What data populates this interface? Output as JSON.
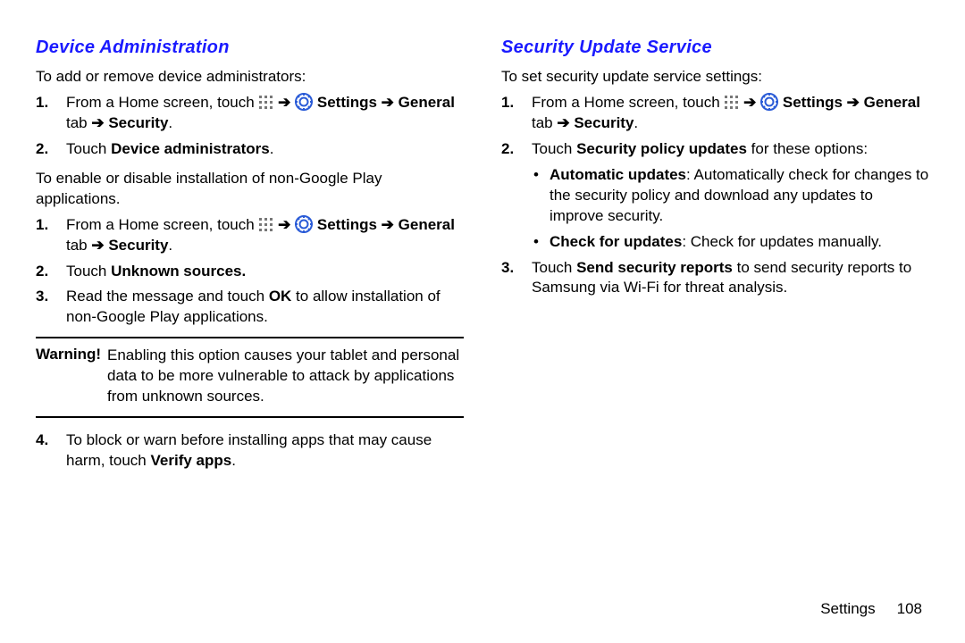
{
  "left": {
    "heading": "Device Administration",
    "intro1": "To add or remove device administrators:",
    "steps1": {
      "s1a": "From a Home screen, touch ",
      "s1b": " Settings ",
      "s1c": "General",
      "s1d": " tab ",
      "s1e": " Security",
      "s2a": "Touch ",
      "s2b": "Device administrators"
    },
    "intro2a": "To enable or disable installation of non-Google Play",
    "intro2b": "applications.",
    "steps2": {
      "s1a": "From a Home screen, touch ",
      "s1b": " Settings ",
      "s1c": "General",
      "s1d": " tab ",
      "s1e": " Security",
      "s2a": "Touch ",
      "s2b": "Unknown sources.",
      "s3a": "Read the message and touch ",
      "s3b": "OK",
      "s3c": " to allow installation of non-Google Play applications."
    },
    "warning_label": "Warning!",
    "warning_text": "Enabling this option causes your tablet and personal data to be more vulnerable to attack by applications from unknown sources.",
    "steps3": {
      "s4a": "To block or warn before installing apps that may cause harm, touch ",
      "s4b": "Verify apps"
    }
  },
  "right": {
    "heading": "Security Update Service",
    "intro": "To set security update service settings:",
    "steps": {
      "s1a": "From a Home screen, touch ",
      "s1b": " Settings ",
      "s1c": "General",
      "s1d": " tab ",
      "s1e": " Security",
      "s2a": "Touch ",
      "s2b": "Security policy updates",
      "s2c": " for these options:",
      "b1a": "Automatic updates",
      "b1b": ": Automatically check for changes to the security policy and download any updates to improve security.",
      "b2a": "Check for updates",
      "b2b": ": Check for updates manually.",
      "s3a": "Touch ",
      "s3b": "Send security reports",
      "s3c": " to send security reports to Samsung via Wi-Fi for threat analysis."
    }
  },
  "footer": {
    "section": "Settings",
    "page": "108"
  },
  "glyphs": {
    "arrow": "➔"
  }
}
